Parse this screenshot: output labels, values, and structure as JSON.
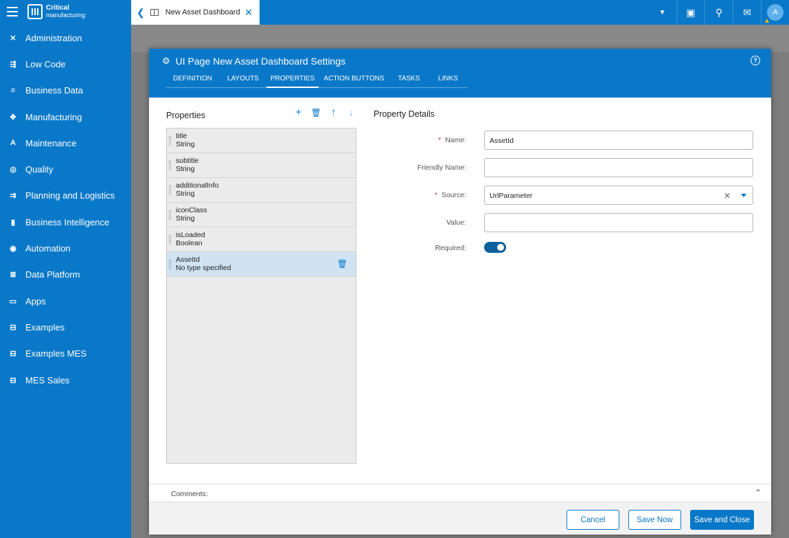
{
  "app": {
    "logo_line1": "Critical",
    "logo_line2": "manufacturing",
    "tab_title": "New Asset Dashboard",
    "user_initial": "A"
  },
  "sidebar": {
    "items": [
      {
        "label": "Administration",
        "icon": "wrench-icon"
      },
      {
        "label": "Low Code",
        "icon": "code-icon"
      },
      {
        "label": "Business Data",
        "icon": "database-icon"
      },
      {
        "label": "Manufacturing",
        "icon": "gears-icon"
      },
      {
        "label": "Maintenance",
        "icon": "maintenance-icon"
      },
      {
        "label": "Quality",
        "icon": "quality-icon"
      },
      {
        "label": "Planning and Logistics",
        "icon": "planning-icon"
      },
      {
        "label": "Business Intelligence",
        "icon": "bar-chart-icon"
      },
      {
        "label": "Automation",
        "icon": "automation-icon"
      },
      {
        "label": "Data Platform",
        "icon": "data-platform-icon"
      },
      {
        "label": "Apps",
        "icon": "apps-icon"
      },
      {
        "label": "Examples",
        "icon": "examples-icon"
      },
      {
        "label": "Examples MES",
        "icon": "examples-mes-icon"
      },
      {
        "label": "MES Sales",
        "icon": "mes-sales-icon"
      }
    ]
  },
  "modal": {
    "title": "UI Page New Asset Dashboard Settings",
    "tabs": [
      "DEFINITION",
      "LAYOUTS",
      "PROPERTIES",
      "ACTION BUTTONS",
      "TASKS",
      "LINKS"
    ],
    "active_tab": "PROPERTIES",
    "properties_title": "Properties",
    "details_title": "Property Details",
    "properties": [
      {
        "name": "title",
        "type": "String"
      },
      {
        "name": "subtitle",
        "type": "String"
      },
      {
        "name": "additionalInfo",
        "type": "String"
      },
      {
        "name": "iconClass",
        "type": "String"
      },
      {
        "name": "isLoaded",
        "type": "Boolean"
      },
      {
        "name": "AssetId",
        "type": "No type specified",
        "selected": true
      }
    ],
    "fields": {
      "name_label": "Name:",
      "name_value": "AssetId",
      "friendly_label": "Friendly Name:",
      "friendly_value": "",
      "source_label": "Source:",
      "source_value": "UrlParameter",
      "value_label": "Value:",
      "value_value": "",
      "required_label": "Required:",
      "required_on": true
    },
    "comments_label": "Comments:",
    "buttons": {
      "cancel": "Cancel",
      "save_now": "Save Now",
      "save_close": "Save and Close"
    }
  },
  "colors": {
    "brand": "#0a78c8",
    "required": "#d32f2f",
    "selected_row": "#cfe3f3"
  }
}
